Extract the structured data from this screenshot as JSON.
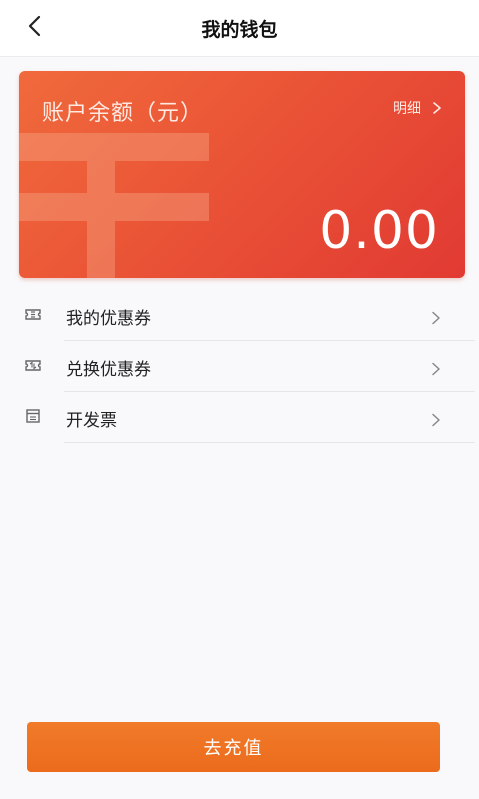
{
  "header": {
    "title": "我的钱包",
    "back_icon": "chevron-left-icon"
  },
  "balance_card": {
    "label": "账户余额（元）",
    "detail_label": "明细",
    "amount": "0.00",
    "watermark_icon": "yuan-symbol-icon",
    "gradient_start": "#f06a3c",
    "gradient_end": "#e13a33"
  },
  "menu": {
    "items": [
      {
        "label": "我的优惠券",
        "icon": "coupon-icon"
      },
      {
        "label": "兑换优惠券",
        "icon": "exchange-coupon-icon"
      },
      {
        "label": "开发票",
        "icon": "invoice-icon"
      }
    ]
  },
  "footer": {
    "recharge_label": "去充值",
    "button_color": "#ec6b1c"
  }
}
